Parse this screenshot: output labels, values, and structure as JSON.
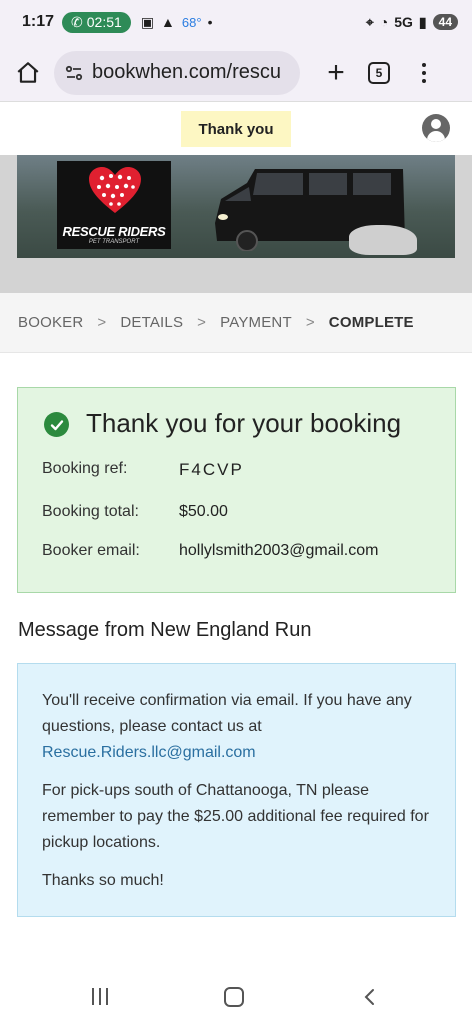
{
  "status_bar": {
    "time": "1:17",
    "call_timer": "02:51",
    "temperature": "68°",
    "network": "5G",
    "battery": "44"
  },
  "browser": {
    "url": "bookwhen.com/rescu",
    "tab_count": "5"
  },
  "header": {
    "thank_you_label": "Thank you"
  },
  "banner": {
    "logo_title": "RESCUE RIDERS",
    "logo_subtitle": "PET TRANSPORT"
  },
  "steps": {
    "items": [
      "BOOKER",
      "DETAILS",
      "PAYMENT",
      "COMPLETE"
    ],
    "separator": ">",
    "active_index": 3
  },
  "confirmation": {
    "title": "Thank you for your booking",
    "ref_label": "Booking ref:",
    "ref_value": "F4CVP",
    "total_label": "Booking total:",
    "total_value": "$50.00",
    "email_label": "Booker email:",
    "email_value": "hollylsmith2003@gmail.com",
    "accent_color": "#2c8a3e"
  },
  "message": {
    "heading": "Message from New England Run",
    "paragraph1": "You'll receive confirmation via email. If you have any questions, please contact us at",
    "contact_email": "Rescue.Riders.llc@gmail.com",
    "paragraph2": "For pick-ups south of Chattanooga, TN please remember to pay the $25.00 additional fee required for pickup locations.",
    "paragraph3": "Thanks so much!"
  }
}
